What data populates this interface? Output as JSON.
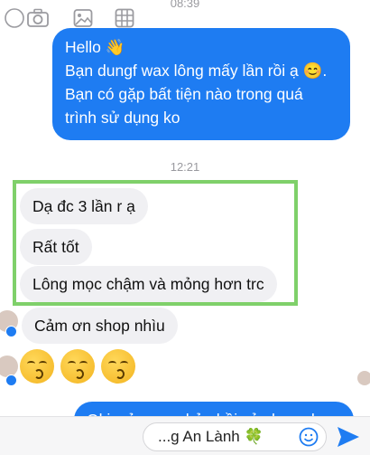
{
  "timestamps": {
    "top": "08:39",
    "mid": "12:21"
  },
  "outgoing_message": {
    "lines": [
      "Hello 👋",
      "Bạn dungf wax lông mấy lần rồi ạ 😊.",
      "Bạn có gặp bất tiện nào trong quá",
      "trình sử dụng ko"
    ]
  },
  "incoming_messages": [
    "Dạ đc 3 lần r ạ",
    "Rất tốt",
    "Lông mọc chậm và mỏng hơn trc",
    "Cảm ơn shop nhìu"
  ],
  "emoji_reaction": "😚😚😚",
  "partial_outgoing": "Oki, cảm ơn phản hồi của bạn nha",
  "composer": {
    "text": "...g An Lành 🍀",
    "icons": [
      "camera-icon",
      "photo-icon",
      "sticker-icon",
      "emoji-icon",
      "send-icon"
    ]
  },
  "colors": {
    "outgoing_bubble": "#1e7cf2",
    "incoming_bubble": "#f0f0f3",
    "highlight_box": "#7fd06a"
  }
}
